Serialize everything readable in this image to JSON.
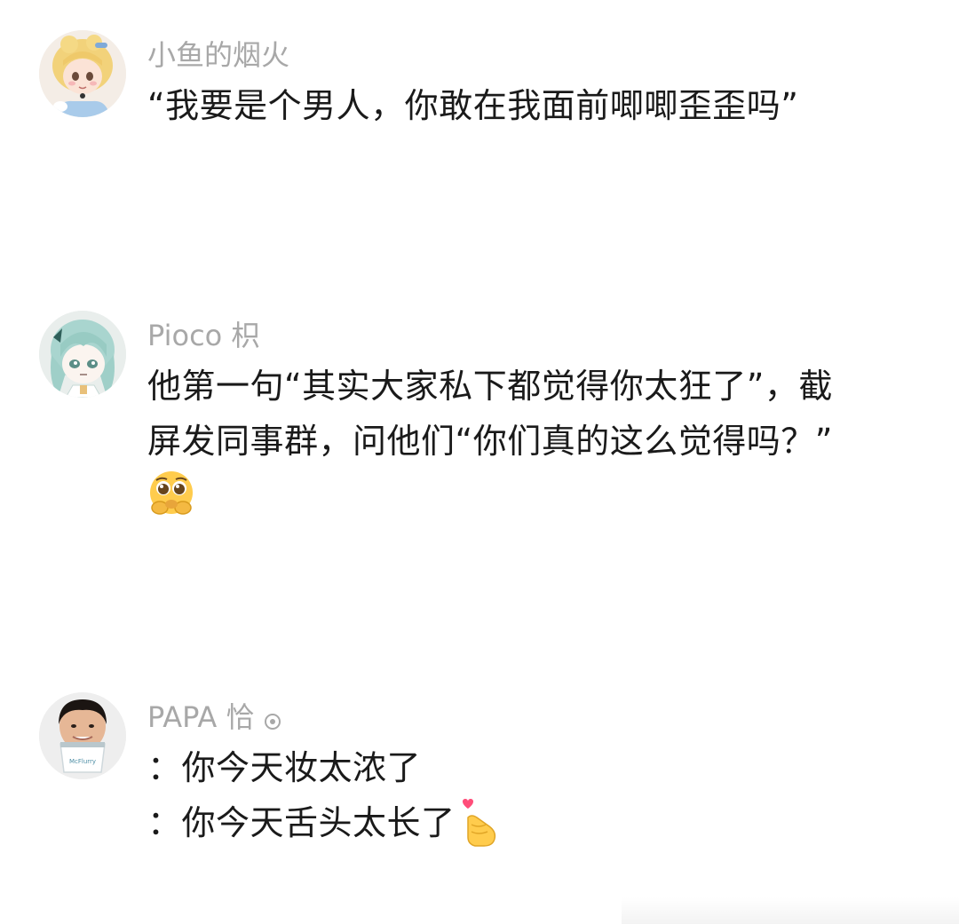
{
  "comments": [
    {
      "username": "小鱼的烟火",
      "avatar_icon": "cartoon-princess-avatar",
      "lines": [
        "“我要是个男人，你敢在我面前唧唧歪歪吗”"
      ]
    },
    {
      "username": "Pioco 枳",
      "avatar_icon": "anime-girl-avatar",
      "lines": [
        "他第一句“其实大家私下都觉得你太狂了”，截",
        "屏发同事群，问他们“你们真的这么觉得吗？”"
      ],
      "trailing_emoji": "pleading-face-emoji"
    },
    {
      "username": "PAPA 恰",
      "username_badge_icon": "circle-badge-icon",
      "avatar_icon": "man-photo-avatar",
      "avatar_cup_text": "McFlurry",
      "lines": [
        "：你今天妆太浓了",
        "：你今天舌头太长了"
      ],
      "trailing_emoji": "finger-heart-emoji"
    }
  ],
  "colors": {
    "username": "#a8a8a8",
    "text": "#1a1a1a",
    "background": "#ffffff"
  }
}
